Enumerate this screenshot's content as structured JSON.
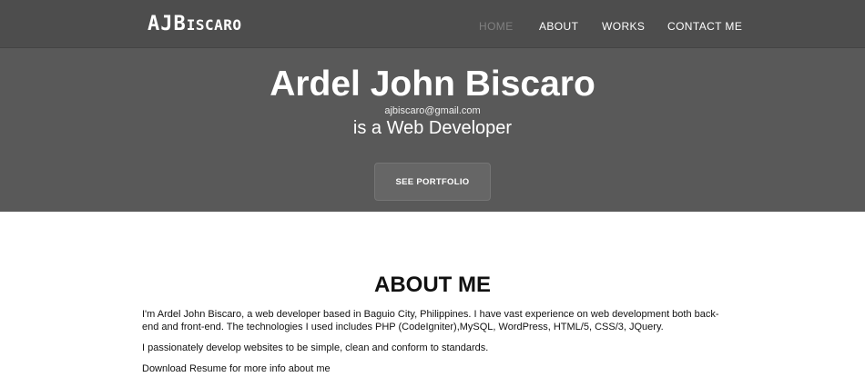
{
  "navbar": {
    "brand_main": "AJB",
    "brand_rest": "ISCARO",
    "links": [
      {
        "label": "HOME"
      },
      {
        "label": "ABOUT"
      },
      {
        "label": "WORKS"
      },
      {
        "label": "CONTACT ME"
      }
    ]
  },
  "hero": {
    "name": "Ardel John Biscaro",
    "email": "ajbiscaro@gmail.com",
    "role": "is a Web Developer",
    "cta_label": "SEE PORTFOLIO"
  },
  "about": {
    "title": "ABOUT ME",
    "paragraph1": "I'm Ardel John Biscaro, a web developer based in Baguio City, Philippines. I have vast experience on web development both back-end and front-end. The technologies I used includes PHP (CodeIgniter),MySQL, WordPress, HTML/5, CSS/3, JQuery.",
    "paragraph2": "I passionately develop websites to be simple, clean and conform to standards.",
    "download_prefix": "Download ",
    "resume_link": "Resume",
    "download_suffix": " for more info about me"
  },
  "colors": {
    "hero_bg": "#595959",
    "navbar_bg": "#4d4d4d",
    "active_nav": "#808080",
    "cta_bg": "#666666"
  }
}
